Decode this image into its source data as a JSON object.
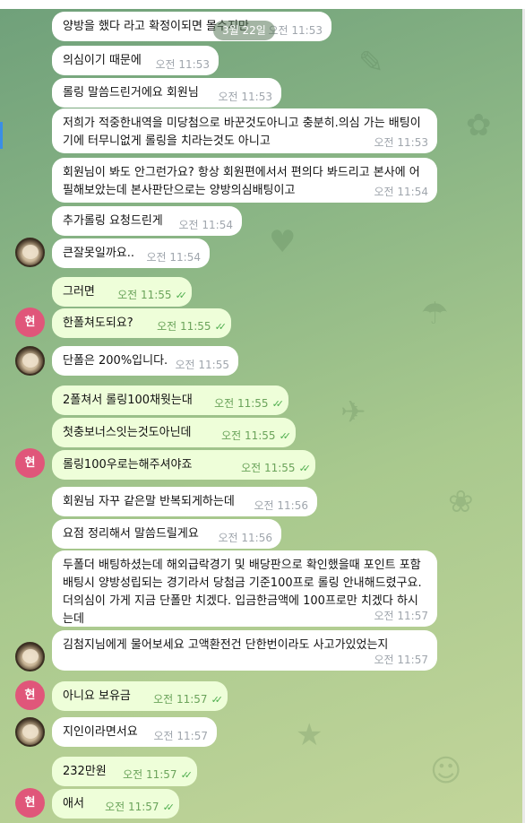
{
  "header": {
    "partial_text": "———"
  },
  "date_label": "3월 22일",
  "messages": [
    {
      "text": "양방을 했다 라고 확정이되면 몰수지만",
      "time": "오전 11:53",
      "dir": "in"
    },
    {
      "text": "의심이기 때문에",
      "time": "오전 11:53",
      "dir": "in"
    },
    {
      "text": "롤링 말씀드린거에요 회원님",
      "time": "오전 11:53",
      "dir": "in"
    },
    {
      "text": "저희가 적중한내역을 미당첨으로 바꾼것도아니고 충분히.의심 가는 배팅이기에 터무니없게 롤링을 치라는것도 아니고",
      "time": "오전 11:53",
      "dir": "in"
    },
    {
      "text": "회원님이 봐도 안그런가요? 항상 회원편에서서 편의다 봐드리고 본사에 어필해보았는데 본사판단으로는 양방의심배팅이고",
      "time": "오전 11:54",
      "dir": "in"
    },
    {
      "text": "추가롤링 요청드린게",
      "time": "오전 11:54",
      "dir": "in"
    },
    {
      "text": "큰잘못일까요..",
      "time": "오전 11:54",
      "dir": "in"
    },
    {
      "text": "그러면",
      "time": "오전 11:55",
      "dir": "out"
    },
    {
      "text": "한폴쳐도되요?",
      "time": "오전 11:55",
      "dir": "out"
    },
    {
      "text": "단폴은 200%입니다.",
      "time": "오전 11:55",
      "dir": "in"
    },
    {
      "text": "2폴쳐서 롤링100채웟는대",
      "time": "오전 11:55",
      "dir": "out"
    },
    {
      "text": "첫충보너스잇는것도아닌데",
      "time": "오전 11:55",
      "dir": "out"
    },
    {
      "text": "롤링100우로는해주셔야죠",
      "time": "오전 11:55",
      "dir": "out"
    },
    {
      "text": "회원님 자꾸 같은말 반복되게하는데",
      "time": "오전 11:56",
      "dir": "in"
    },
    {
      "text": "요점 정리해서 말씀드릴게요",
      "time": "오전 11:56",
      "dir": "in"
    },
    {
      "text": "두폴더 배팅하셨는데 해외급락경기 및 배당판으로 확인했을때 포인트 포함 배팅시 양방성립되는 경기라서 당첨금 기준100프로 롤링 안내해드렸구요. 더의심이 가게 지금 단폴만 치겠다. 입금한금액에 100프로만 치겠다 하시는데",
      "time": "오전 11:57",
      "dir": "in"
    },
    {
      "text": "김첨지님에게 물어보세요 고액환전건 단한번이라도 사고가있었는지",
      "time": "오전 11:57",
      "dir": "in"
    },
    {
      "text": "아니요 보유금",
      "time": "오전 11:57",
      "dir": "out"
    },
    {
      "text": "지인이라면서요",
      "time": "오전 11:57",
      "dir": "in"
    },
    {
      "text": "232만원",
      "time": "오전 11:57",
      "dir": "out"
    },
    {
      "text": "애서",
      "time": "오전 11:57",
      "dir": "out"
    }
  ],
  "avatar_letter": "현",
  "colors": {
    "incoming": "#ffffff",
    "outgoing": "#eefed9",
    "tick": "#4fae4e",
    "avatar": "#e0567a"
  }
}
